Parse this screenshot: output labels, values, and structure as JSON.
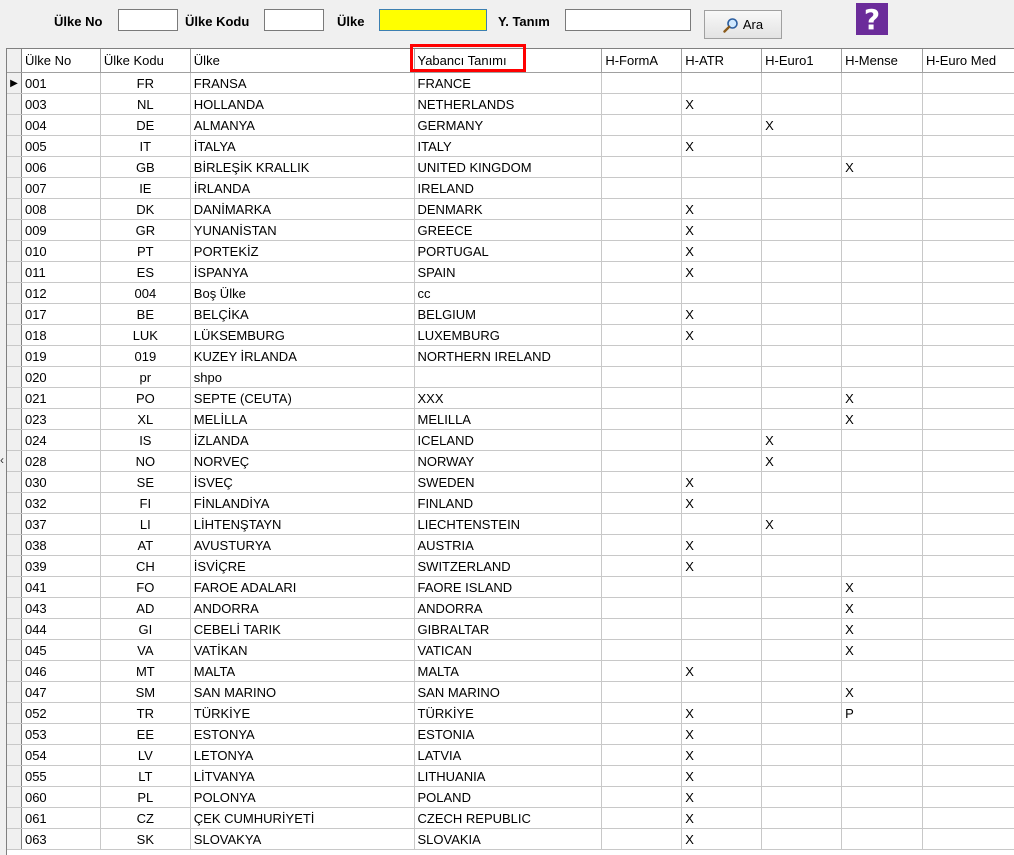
{
  "search": {
    "ulke_no_label": "Ülke No",
    "ulke_kodu_label": "Ülke Kodu",
    "ulke_label": "Ülke",
    "y_tanim_label": "Y. Tanım",
    "ulke_no_value": "",
    "ulke_kodu_value": "",
    "ulke_value": "",
    "y_tanim_value": "",
    "ara_label": "Ara",
    "help_glyph": "?"
  },
  "colors": {
    "highlight_input": "#ffff00",
    "help_button": "#6b2c9a",
    "annotation_box": "#ff0000"
  },
  "grid": {
    "columns": [
      "Ülke No",
      "Ülke Kodu",
      "Ülke",
      "Yabancı Tanımı",
      "H-FormA",
      "H-ATR",
      "H-Euro1",
      "H-Mense",
      "H-Euro Med"
    ],
    "rows": [
      [
        "001",
        "FR",
        "FRANSA",
        "FRANCE",
        "",
        "",
        "",
        "",
        ""
      ],
      [
        "003",
        "NL",
        "HOLLANDA",
        "NETHERLANDS",
        "",
        "X",
        "",
        "",
        ""
      ],
      [
        "004",
        "DE",
        "ALMANYA",
        "GERMANY",
        "",
        "",
        "X",
        "",
        ""
      ],
      [
        "005",
        "IT",
        "İTALYA",
        "ITALY",
        "",
        "X",
        "",
        "",
        ""
      ],
      [
        "006",
        "GB",
        "BİRLEŞİK KRALLIK",
        "UNITED KINGDOM",
        "",
        "",
        "",
        "X",
        ""
      ],
      [
        "007",
        "IE",
        "İRLANDA",
        "IRELAND",
        "",
        "",
        "",
        "",
        ""
      ],
      [
        "008",
        "DK",
        "DANİMARKA",
        "DENMARK",
        "",
        "X",
        "",
        "",
        ""
      ],
      [
        "009",
        "GR",
        "YUNANİSTAN",
        "GREECE",
        "",
        "X",
        "",
        "",
        ""
      ],
      [
        "010",
        "PT",
        "PORTEKİZ",
        "PORTUGAL",
        "",
        "X",
        "",
        "",
        ""
      ],
      [
        "011",
        "ES",
        "İSPANYA",
        "SPAIN",
        "",
        "X",
        "",
        "",
        ""
      ],
      [
        "012",
        "004",
        "Boş Ülke",
        "cc",
        "",
        "",
        "",
        "",
        ""
      ],
      [
        "017",
        "BE",
        "BELÇİKA",
        "BELGIUM",
        "",
        "X",
        "",
        "",
        ""
      ],
      [
        "018",
        "LUK",
        "LÜKSEMBURG",
        "LUXEMBURG",
        "",
        "X",
        "",
        "",
        ""
      ],
      [
        "019",
        "019",
        "KUZEY İRLANDA",
        "NORTHERN IRELAND",
        "",
        "",
        "",
        "",
        ""
      ],
      [
        "020",
        "pr",
        "shpo",
        "",
        "",
        "",
        "",
        "",
        ""
      ],
      [
        "021",
        "PO",
        "SEPTE (CEUTA)",
        "XXX",
        "",
        "",
        "",
        "X",
        ""
      ],
      [
        "023",
        "XL",
        "MELİLLA",
        "MELILLA",
        "",
        "",
        "",
        "X",
        ""
      ],
      [
        "024",
        "IS",
        "İZLANDA",
        "ICELAND",
        "",
        "",
        "X",
        "",
        ""
      ],
      [
        "028",
        "NO",
        "NORVEÇ",
        "NORWAY",
        "",
        "",
        "X",
        "",
        ""
      ],
      [
        "030",
        "SE",
        "İSVEÇ",
        "SWEDEN",
        "",
        "X",
        "",
        "",
        ""
      ],
      [
        "032",
        "FI",
        "FİNLANDİYA",
        "FINLAND",
        "",
        "X",
        "",
        "",
        ""
      ],
      [
        "037",
        "LI",
        "LİHTENŞTAYN",
        "LIECHTENSTEIN",
        "",
        "",
        "X",
        "",
        ""
      ],
      [
        "038",
        "AT",
        "AVUSTURYA",
        "AUSTRIA",
        "",
        "X",
        "",
        "",
        ""
      ],
      [
        "039",
        "CH",
        "İSVİÇRE",
        "SWITZERLAND",
        "",
        "X",
        "",
        "",
        ""
      ],
      [
        "041",
        "FO",
        "FAROE ADALARI",
        "FAORE ISLAND",
        "",
        "",
        "",
        "X",
        ""
      ],
      [
        "043",
        "AD",
        "ANDORRA",
        "ANDORRA",
        "",
        "",
        "",
        "X",
        ""
      ],
      [
        "044",
        "GI",
        "CEBELİ TARIK",
        "GIBRALTAR",
        "",
        "",
        "",
        "X",
        ""
      ],
      [
        "045",
        "VA",
        "VATİKAN",
        "VATICAN",
        "",
        "",
        "",
        "X",
        ""
      ],
      [
        "046",
        "MT",
        "MALTA",
        "MALTA",
        "",
        "X",
        "",
        "",
        ""
      ],
      [
        "047",
        "SM",
        "SAN MARINO",
        "SAN MARINO",
        "",
        "",
        "",
        "X",
        ""
      ],
      [
        "052",
        "TR",
        "TÜRKİYE",
        "TÜRKİYE",
        "",
        "X",
        "",
        "P",
        ""
      ],
      [
        "053",
        "EE",
        "ESTONYA",
        "ESTONIA",
        "",
        "X",
        "",
        "",
        ""
      ],
      [
        "054",
        "LV",
        "LETONYA",
        "LATVIA",
        "",
        "X",
        "",
        "",
        ""
      ],
      [
        "055",
        "LT",
        "LİTVANYA",
        "LITHUANIA",
        "",
        "X",
        "",
        "",
        ""
      ],
      [
        "060",
        "PL",
        "POLONYA",
        "POLAND",
        "",
        "X",
        "",
        "",
        ""
      ],
      [
        "061",
        "CZ",
        "ÇEK CUMHURİYETİ",
        "CZECH REPUBLIC",
        "",
        "X",
        "",
        "",
        ""
      ],
      [
        "063",
        "SK",
        "SLOVAKYA",
        "SLOVAKIA",
        "",
        "X",
        "",
        "",
        ""
      ]
    ]
  }
}
